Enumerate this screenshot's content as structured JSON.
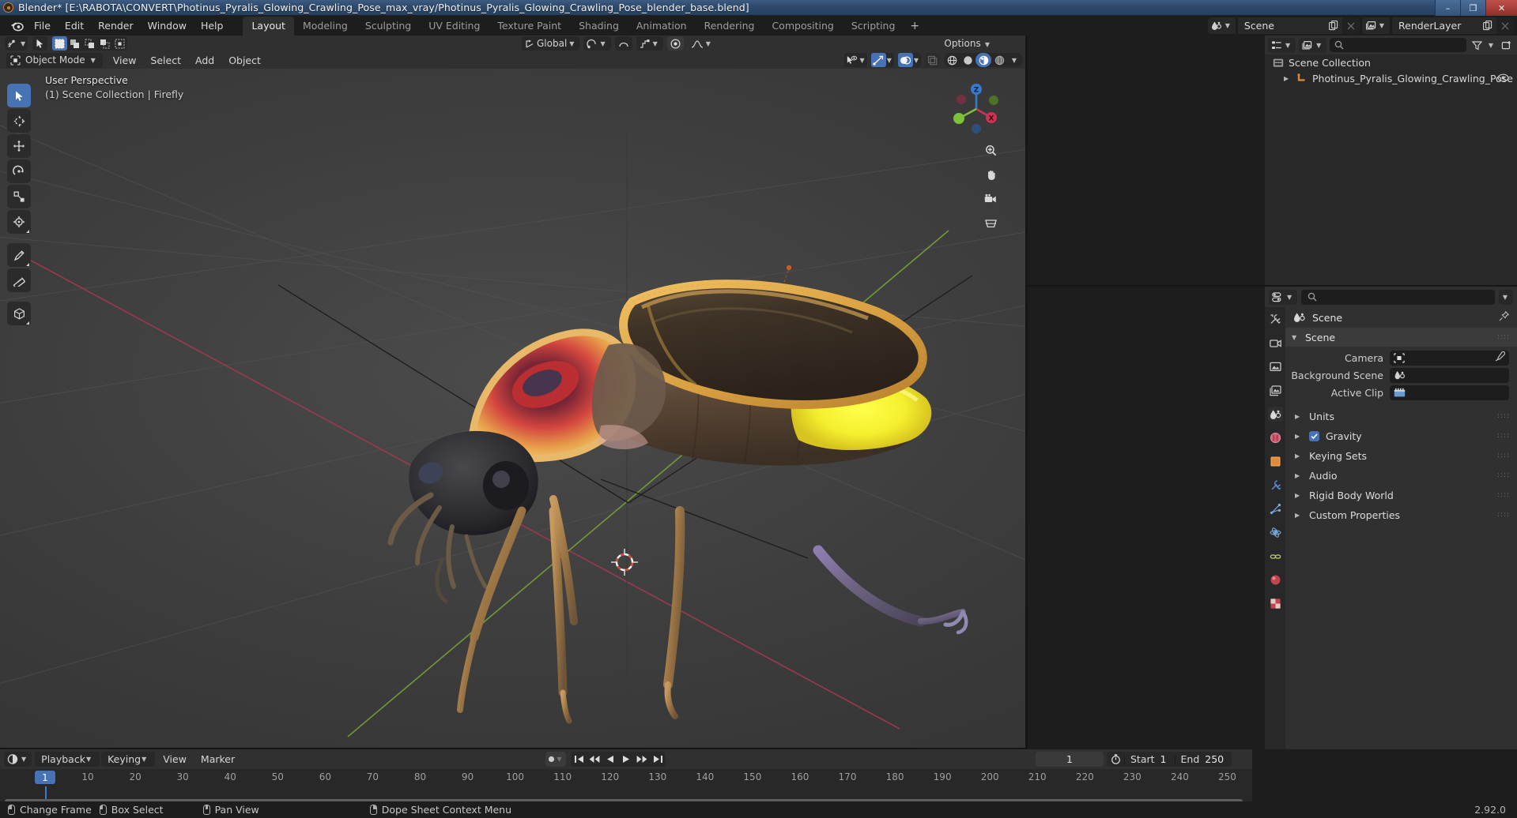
{
  "window": {
    "title": "Blender* [E:\\RABOTA\\CONVERT\\Photinus_Pyralis_Glowing_Crawling_Pose_max_vray/Photinus_Pyralis_Glowing_Crawling_Pose_blender_base.blend]",
    "minimize": "–",
    "maximize": "❐",
    "close": "✕"
  },
  "topbar": {
    "menus": [
      "File",
      "Edit",
      "Render",
      "Window",
      "Help"
    ],
    "workspaces": [
      "Layout",
      "Modeling",
      "Sculpting",
      "UV Editing",
      "Texture Paint",
      "Shading",
      "Animation",
      "Rendering",
      "Compositing",
      "Scripting"
    ],
    "active_workspace": "Layout",
    "add_workspace": "+",
    "scene_name": "Scene",
    "view_layer_name": "RenderLayer"
  },
  "tool_header": {
    "transform_orientation": "Global",
    "options_label": "Options"
  },
  "viewport_header": {
    "mode": "Object Mode",
    "menus": [
      "View",
      "Select",
      "Add",
      "Object"
    ]
  },
  "viewport": {
    "overlay_line1": "User Perspective",
    "overlay_line2": "(1) Scene Collection | Firefly",
    "gizmo_axes": [
      "X",
      "Y",
      "Z"
    ],
    "colors": {
      "x_axis": "#cc3355",
      "y_axis": "#7dc03a",
      "z_axis": "#3a78cc",
      "accent_blue": "#4772b3",
      "active_orange": "#e8a33d"
    }
  },
  "outliner": {
    "rows": [
      {
        "label": "Scene Collection",
        "indent": 0,
        "icon": "collection-icon"
      },
      {
        "label": "Photinus_Pyralis_Glowing_Crawling_Pose",
        "indent": 1,
        "icon": "armature-icon"
      }
    ]
  },
  "properties": {
    "breadcrumb": "Scene",
    "panel_title": "Scene",
    "rows": [
      {
        "label": "Camera",
        "value": ""
      },
      {
        "label": "Background Scene",
        "value": ""
      },
      {
        "label": "Active Clip",
        "value": ""
      }
    ],
    "closed_panels": [
      {
        "label": "Units",
        "checkbox": false
      },
      {
        "label": "Gravity",
        "checkbox": true
      },
      {
        "label": "Keying Sets",
        "checkbox": false
      },
      {
        "label": "Audio",
        "checkbox": false
      },
      {
        "label": "Rigid Body World",
        "checkbox": false
      },
      {
        "label": "Custom Properties",
        "checkbox": false
      }
    ]
  },
  "timeline": {
    "menus": [
      "Playback",
      "Keying",
      "View",
      "Marker"
    ],
    "current_frame": "1",
    "start_label": "Start",
    "start_value": "1",
    "end_label": "End",
    "end_value": "250",
    "ticks": [
      {
        "label": "10",
        "frame": 10
      },
      {
        "label": "20",
        "frame": 20
      },
      {
        "label": "30",
        "frame": 30
      },
      {
        "label": "40",
        "frame": 40
      },
      {
        "label": "50",
        "frame": 50
      },
      {
        "label": "60",
        "frame": 60
      },
      {
        "label": "70",
        "frame": 70
      },
      {
        "label": "80",
        "frame": 80
      },
      {
        "label": "90",
        "frame": 90
      },
      {
        "label": "100",
        "frame": 100
      },
      {
        "label": "110",
        "frame": 110
      },
      {
        "label": "120",
        "frame": 120
      },
      {
        "label": "130",
        "frame": 130
      },
      {
        "label": "140",
        "frame": 140
      },
      {
        "label": "150",
        "frame": 150
      },
      {
        "label": "160",
        "frame": 160
      },
      {
        "label": "170",
        "frame": 170
      },
      {
        "label": "180",
        "frame": 180
      },
      {
        "label": "190",
        "frame": 190
      },
      {
        "label": "200",
        "frame": 200
      },
      {
        "label": "210",
        "frame": 210
      },
      {
        "label": "220",
        "frame": 220
      },
      {
        "label": "230",
        "frame": 230
      },
      {
        "label": "240",
        "frame": 240
      },
      {
        "label": "250",
        "frame": 250
      }
    ],
    "playhead_label": "1"
  },
  "statusbar": {
    "items": [
      {
        "mouse": "left",
        "label": "Change Frame"
      },
      {
        "mouse": "left-mid",
        "label": "Box Select"
      },
      {
        "mouse": "middle",
        "label": "Pan View"
      },
      {
        "mouse": "right",
        "label": "Dope Sheet Context Menu"
      }
    ],
    "version": "2.92.0"
  }
}
